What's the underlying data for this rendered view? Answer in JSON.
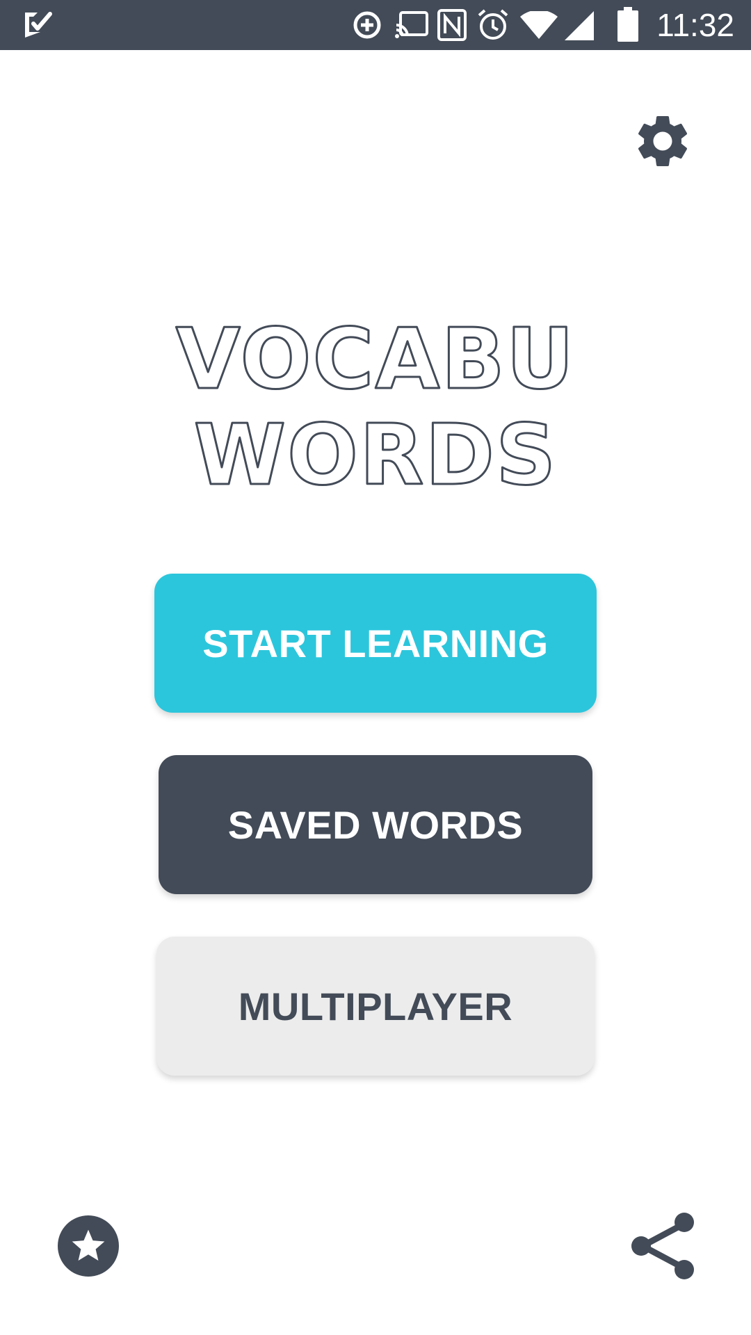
{
  "status_bar": {
    "time": "11:32",
    "icons": [
      "check-notification-icon",
      "data-saver-icon",
      "cast-icon",
      "nfc-icon",
      "alarm-icon",
      "wifi-icon",
      "cell-signal-icon",
      "battery-icon"
    ]
  },
  "header": {
    "settings_icon": "gear-icon"
  },
  "logo": {
    "line1": "VOCABU",
    "line2": "WORDS"
  },
  "menu": {
    "start_label": "START LEARNING",
    "saved_label": "SAVED WORDS",
    "multiplayer_label": "MULTIPLAYER"
  },
  "footer": {
    "rate_icon": "star-icon",
    "share_icon": "share-icon"
  },
  "colors": {
    "accent": "#2cc6dc",
    "dark": "#434b58",
    "light_button": "#ececec",
    "background": "#ffffff"
  }
}
